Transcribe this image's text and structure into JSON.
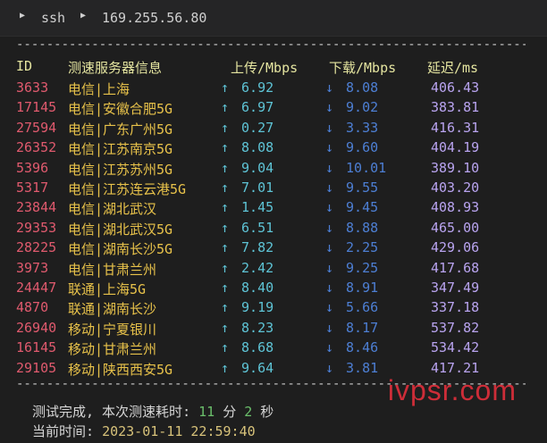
{
  "breadcrumb": {
    "items": [
      "ssh",
      "169.255.56.80"
    ]
  },
  "table": {
    "dashes": "--------------------------------------------------------------------------------",
    "headers": {
      "id": "ID",
      "node": "测速服务器信息",
      "upload": "上传/Mbps",
      "download": "下载/Mbps",
      "latency": "延迟/ms"
    },
    "rows": [
      {
        "id": "3633",
        "node": "电信|上海",
        "up": "6.92",
        "down": "8.08",
        "lat": "406.43"
      },
      {
        "id": "17145",
        "node": "电信|安徽合肥5G",
        "up": "6.97",
        "down": "9.02",
        "lat": "383.81"
      },
      {
        "id": "27594",
        "node": "电信|广东广州5G",
        "up": "0.27",
        "down": "3.33",
        "lat": "416.31"
      },
      {
        "id": "26352",
        "node": "电信|江苏南京5G",
        "up": "8.08",
        "down": "9.60",
        "lat": "404.19"
      },
      {
        "id": "5396",
        "node": "电信|江苏苏州5G",
        "up": "9.04",
        "down": "10.01",
        "lat": "389.10"
      },
      {
        "id": "5317",
        "node": "电信|江苏连云港5G",
        "up": "7.01",
        "down": "9.55",
        "lat": "403.20"
      },
      {
        "id": "23844",
        "node": "电信|湖北武汉",
        "up": "1.45",
        "down": "9.45",
        "lat": "408.93"
      },
      {
        "id": "29353",
        "node": "电信|湖北武汉5G",
        "up": "6.51",
        "down": "8.88",
        "lat": "465.00"
      },
      {
        "id": "28225",
        "node": "电信|湖南长沙5G",
        "up": "7.82",
        "down": "2.25",
        "lat": "429.06"
      },
      {
        "id": "3973",
        "node": "电信|甘肃兰州",
        "up": "2.42",
        "down": "9.25",
        "lat": "417.68"
      },
      {
        "id": "24447",
        "node": "联通|上海5G",
        "up": "8.40",
        "down": "8.91",
        "lat": "347.49"
      },
      {
        "id": "4870",
        "node": "联通|湖南长沙",
        "up": "9.19",
        "down": "5.66",
        "lat": "337.18"
      },
      {
        "id": "26940",
        "node": "移动|宁夏银川",
        "up": "8.23",
        "down": "8.17",
        "lat": "537.82"
      },
      {
        "id": "16145",
        "node": "移动|甘肃兰州",
        "up": "8.68",
        "down": "8.46",
        "lat": "534.42"
      },
      {
        "id": "29105",
        "node": "移动|陕西西安5G",
        "up": "9.64",
        "down": "3.81",
        "lat": "417.21"
      }
    ]
  },
  "footer": {
    "done_prefix": "测试完成, 本次测速耗时: ",
    "minutes": "11",
    "min_unit": " 分 ",
    "seconds": "2",
    "sec_unit": " 秒",
    "time_label": "当前时间: ",
    "time_value": "2023-01-11 22:59:40"
  },
  "watermark": "ivpsr.com",
  "icons": {
    "chevron": "chevron-right-icon",
    "up": "arrow-up-icon",
    "down": "arrow-down-icon"
  },
  "colors": {
    "background": "#1e1e1e",
    "id": "#e05a6e",
    "node": "#e8c24a",
    "upload": "#5ec4d6",
    "download": "#4d7fd4",
    "latency": "#b9a4f0",
    "watermark": "#e02f3b"
  }
}
